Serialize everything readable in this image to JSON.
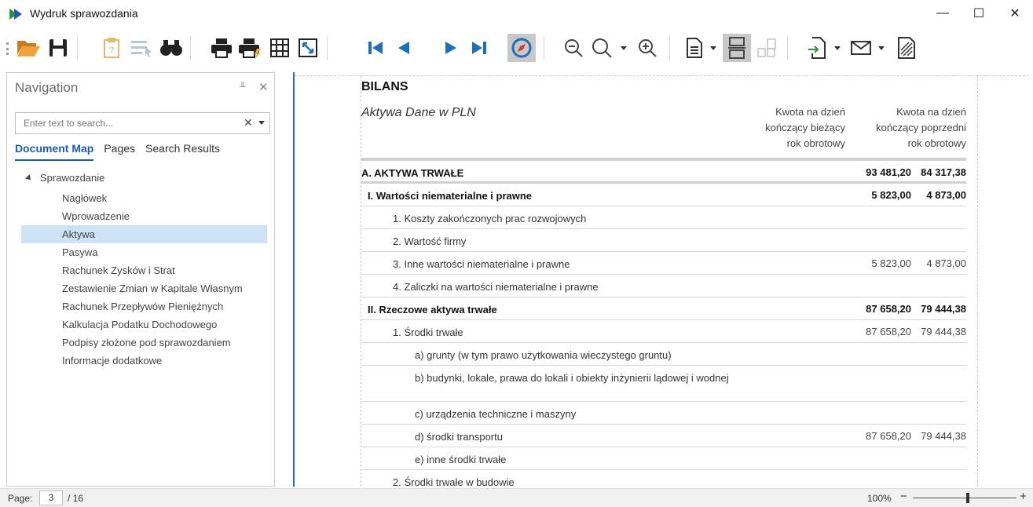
{
  "window": {
    "title": "Wydruk sprawozdania",
    "minimize_glyph": "—",
    "maximize_glyph": "☐",
    "close_glyph": "✕"
  },
  "toolbar": {
    "buttons": [
      {
        "name": "open-file-icon",
        "label": "Open"
      },
      {
        "name": "save-icon",
        "label": "Save"
      },
      {
        "name": "parameters-icon",
        "label": "Parameters"
      },
      {
        "name": "editing-fields-icon",
        "label": "Editing Fields"
      },
      {
        "name": "find-icon",
        "label": "Search"
      },
      {
        "name": "print-icon",
        "label": "Print"
      },
      {
        "name": "quick-print-icon",
        "label": "Quick Print"
      },
      {
        "name": "page-setup-icon",
        "label": "Page Setup"
      },
      {
        "name": "scale-icon",
        "label": "Scale"
      },
      {
        "name": "first-page-icon",
        "label": "First Page"
      },
      {
        "name": "previous-page-icon",
        "label": "Previous Page"
      },
      {
        "name": "next-page-icon",
        "label": "Next Page"
      },
      {
        "name": "last-page-icon",
        "label": "Last Page"
      },
      {
        "name": "navigation-compass-icon",
        "label": "Navigation"
      },
      {
        "name": "zoom-out-icon",
        "label": "Zoom Out"
      },
      {
        "name": "zoom-icon",
        "label": "Zoom"
      },
      {
        "name": "zoom-in-icon",
        "label": "Zoom In"
      },
      {
        "name": "page-layout-icon",
        "label": "Page Layout"
      },
      {
        "name": "continuous-layout-icon",
        "label": "Continuous"
      },
      {
        "name": "multiple-pages-icon",
        "label": "Multiple Pages"
      },
      {
        "name": "export-icon",
        "label": "Export"
      },
      {
        "name": "send-email-icon",
        "label": "Send via Email"
      },
      {
        "name": "watermark-icon",
        "label": "Watermark"
      }
    ]
  },
  "navigation": {
    "title": "Navigation",
    "pin_glyph": "╨",
    "close_glyph": "✕",
    "search_placeholder": "Enter text to search...",
    "search_clear_glyph": "✕",
    "tabs": [
      {
        "label": "Document Map",
        "active": true
      },
      {
        "label": "Pages",
        "active": false
      },
      {
        "label": "Search Results",
        "active": false
      }
    ],
    "tree_root": "Sprawozdanie",
    "tree_items": [
      {
        "label": "Nagłówek",
        "selected": false
      },
      {
        "label": "Wprowadzenie",
        "selected": false
      },
      {
        "label": "Aktywa",
        "selected": true
      },
      {
        "label": "Pasywa",
        "selected": false
      },
      {
        "label": "Rachunek Zysków i Strat",
        "selected": false
      },
      {
        "label": "Zestawienie Zmian w Kapitale Własnym",
        "selected": false
      },
      {
        "label": "Rachunek Przepływów Pieniężnych",
        "selected": false
      },
      {
        "label": "Kalkulacja Podatku Dochodowego",
        "selected": false
      },
      {
        "label": "Podpisy złożone pod sprawozdaniem",
        "selected": false
      },
      {
        "label": "Informacje dodatkowe",
        "selected": false
      }
    ]
  },
  "report": {
    "title": "BILANS",
    "subtitle": "Aktywa Dane w PLN",
    "col1_header": [
      "Kwota na dzień",
      "kończący bieżący",
      "rok obrotowy"
    ],
    "col2_header": [
      "Kwota na dzień",
      "kończący poprzedni",
      "rok obrotowy"
    ],
    "rows": [
      {
        "label": "A. AKTYWA TRWAŁE",
        "v1": "93 481,20",
        "v2": "84 317,38",
        "level": 0,
        "bold": true
      },
      {
        "label": "I. Wartości niematerialne i prawne",
        "v1": "5 823,00",
        "v2": "4 873,00",
        "level": 1,
        "bold": true
      },
      {
        "label": "1. Koszty zakończonych prac rozwojowych",
        "v1": "",
        "v2": "",
        "level": 2,
        "bold": false
      },
      {
        "label": "2. Wartość firmy",
        "v1": "",
        "v2": "",
        "level": 2,
        "bold": false
      },
      {
        "label": "3. Inne wartości niematerialne i prawne",
        "v1": "5 823,00",
        "v2": "4 873,00",
        "level": 2,
        "bold": false
      },
      {
        "label": "4. Zaliczki na wartości niematerialne i prawne",
        "v1": "",
        "v2": "",
        "level": 2,
        "bold": false
      },
      {
        "label": "II. Rzeczowe aktywa trwałe",
        "v1": "87 658,20",
        "v2": "79 444,38",
        "level": 1,
        "bold": true
      },
      {
        "label": "1. Środki trwałe",
        "v1": "87 658,20",
        "v2": "79 444,38",
        "level": 2,
        "bold": false
      },
      {
        "label": "a) grunty (w tym prawo użytkowania wieczystego gruntu)",
        "v1": "",
        "v2": "",
        "level": 3,
        "bold": false
      },
      {
        "label": "b) budynki, lokale, prawa do lokali i obiekty inżynierii lądowej i wodnej",
        "v1": "",
        "v2": "",
        "level": 3,
        "bold": false,
        "tall": true
      },
      {
        "label": "c) urządzenia techniczne i maszyny",
        "v1": "",
        "v2": "",
        "level": 3,
        "bold": false
      },
      {
        "label": "d) środki transportu",
        "v1": "87 658,20",
        "v2": "79 444,38",
        "level": 3,
        "bold": false
      },
      {
        "label": "e) inne środki trwałe",
        "v1": "",
        "v2": "",
        "level": 3,
        "bold": false
      },
      {
        "label": "2. Środki trwałe w budowie",
        "v1": "",
        "v2": "",
        "level": 2,
        "bold": false
      }
    ]
  },
  "statusbar": {
    "page_label": "Page:",
    "page_value": "3",
    "page_total": "/ 16",
    "zoom": "100%",
    "zoom_level": 0.5,
    "zoom_minus": "−",
    "zoom_plus": "+"
  }
}
